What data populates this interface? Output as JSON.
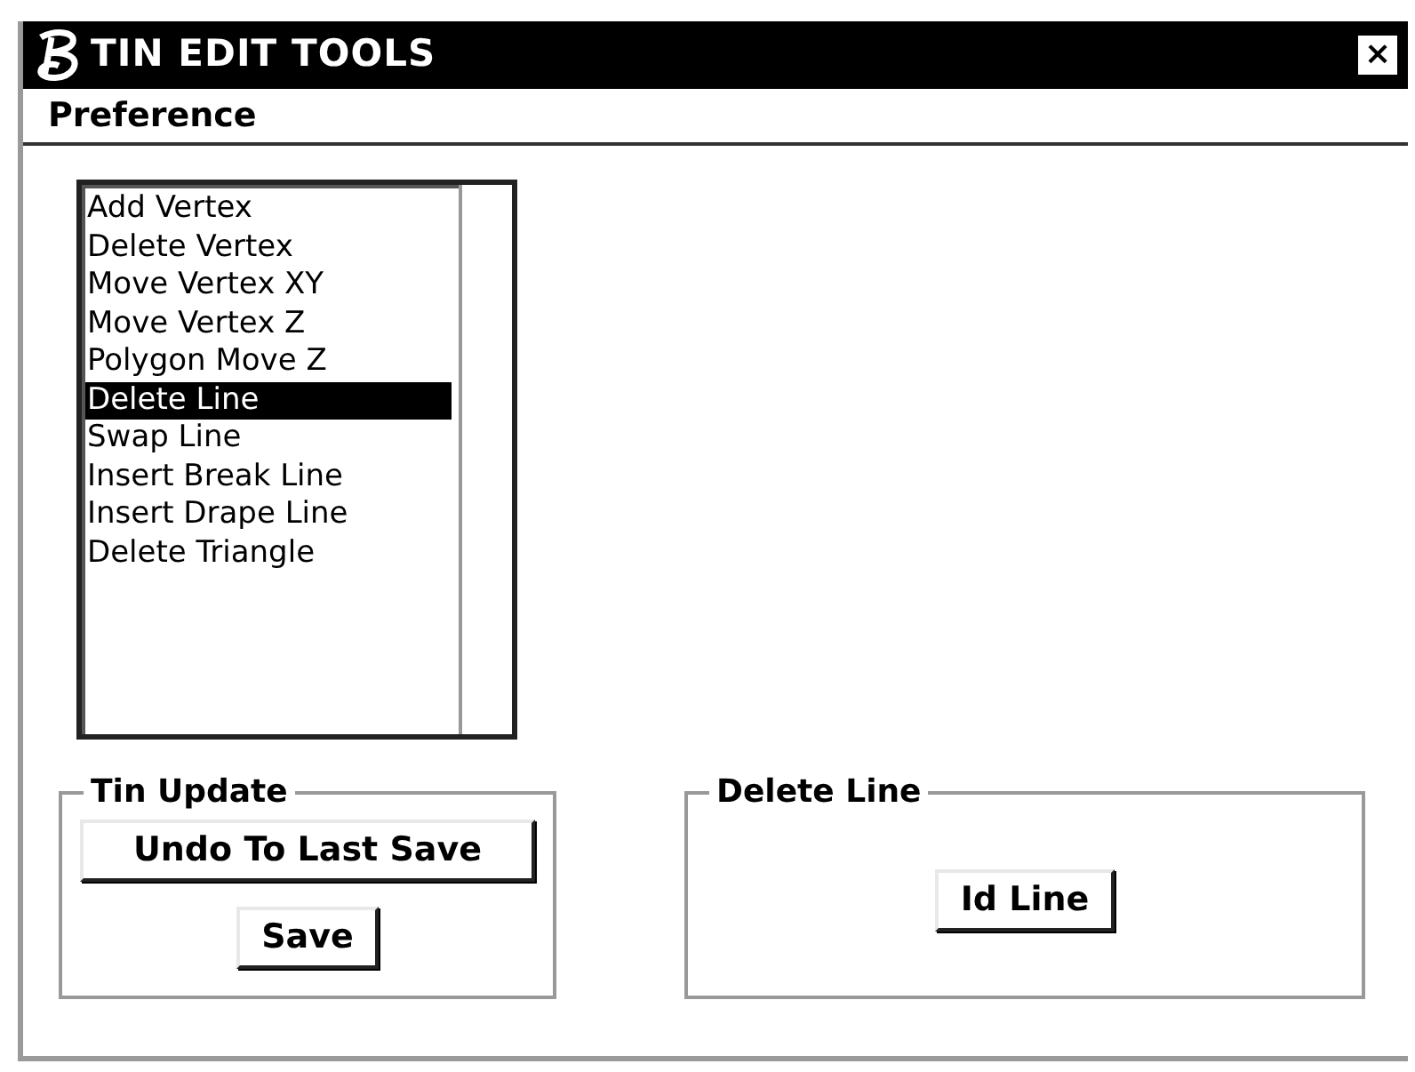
{
  "window": {
    "title": "TIN EDIT TOOLS",
    "close": "×"
  },
  "menu": [
    "Preference"
  ],
  "tools": [
    {
      "label": "Add Vertex",
      "selected": false
    },
    {
      "label": "Delete Vertex",
      "selected": false
    },
    {
      "label": "Move Vertex XY",
      "selected": false
    },
    {
      "label": "Move Vertex Z",
      "selected": false
    },
    {
      "label": "Polygon Move Z",
      "selected": false
    },
    {
      "label": "Delete Line",
      "selected": true
    },
    {
      "label": "Swap Line",
      "selected": false
    },
    {
      "label": "Insert Break Line",
      "selected": false
    },
    {
      "label": "Insert Drape Line",
      "selected": false
    },
    {
      "label": "Delete Triangle",
      "selected": false
    }
  ],
  "tin_update": {
    "title": "Tin Update",
    "buttons": [
      "Undo To Last Save",
      "Save"
    ]
  },
  "tool_panel": {
    "title": "Delete Line",
    "buttons": [
      "Id Line"
    ]
  }
}
